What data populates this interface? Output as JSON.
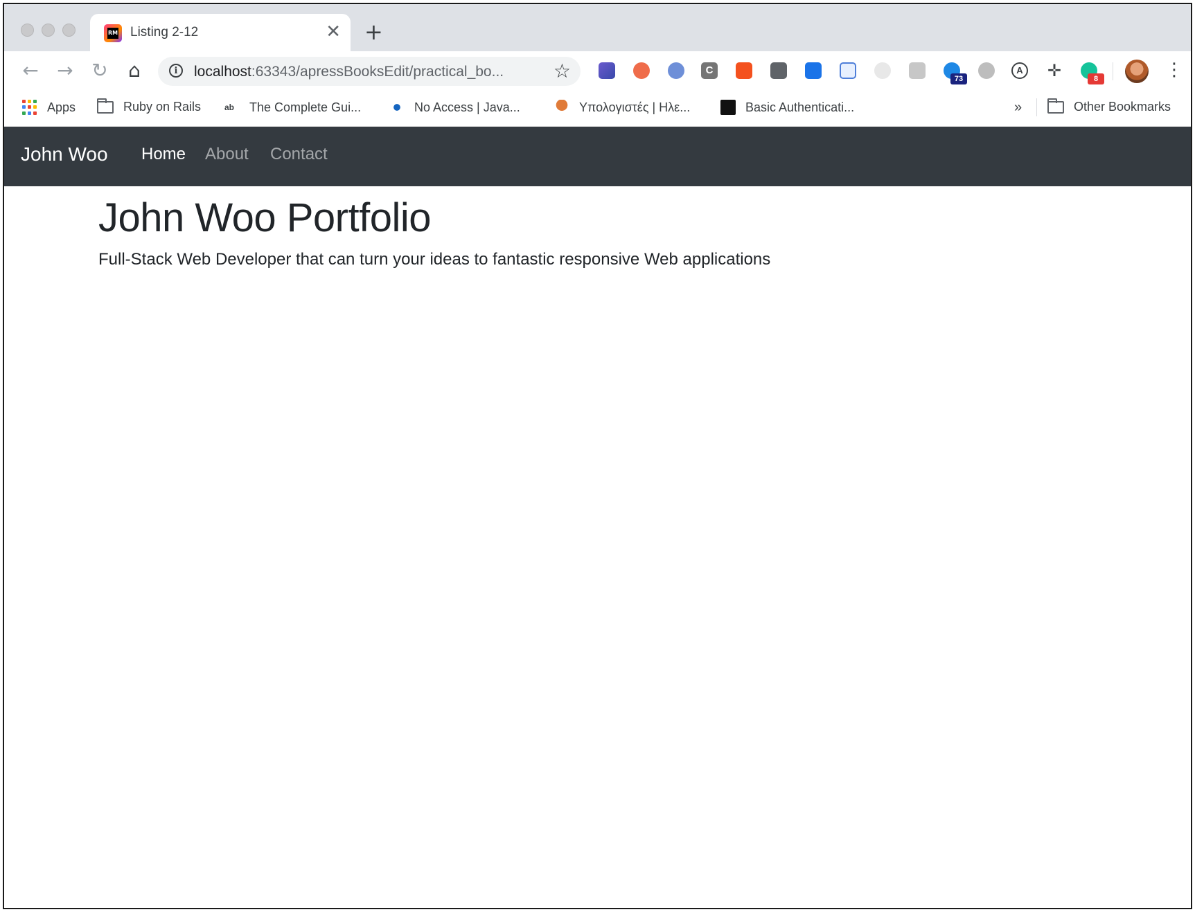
{
  "browser": {
    "tab": {
      "title": "Listing 2-12",
      "favicon": "RM"
    },
    "address": {
      "host": "localhost",
      "rest": ":63343/apressBooksEdit/practical_bo..."
    },
    "extensions": [
      {
        "name": "eyedropper-icon",
        "badge": ""
      },
      {
        "name": "tree-icon",
        "badge": ""
      },
      {
        "name": "opera-icon",
        "badge": ""
      },
      {
        "name": "c-icon",
        "badge": ""
      },
      {
        "name": "gear-icon",
        "badge": ""
      },
      {
        "name": "lightbulb-icon",
        "badge": ""
      },
      {
        "name": "download-icon",
        "badge": ""
      },
      {
        "name": "speed-icon",
        "badge": ""
      },
      {
        "name": "react-icon",
        "badge": ""
      },
      {
        "name": "chat-icon",
        "badge": ""
      },
      {
        "name": "cloud-icon",
        "badge": "73"
      },
      {
        "name": "vpn-icon",
        "badge": ""
      },
      {
        "name": "a-circle-icon",
        "badge": ""
      },
      {
        "name": "ruler-icon",
        "badge": ""
      },
      {
        "name": "grammarly-icon",
        "badge": "8"
      }
    ],
    "bookmarks": {
      "apps": "Apps",
      "items": [
        "Ruby on Rails",
        "The Complete Gui...",
        "No Access | Java...",
        "Υπολογιστές | Ηλε...",
        "Basic Authenticati..."
      ],
      "overflow": "»",
      "other": "Other Bookmarks"
    },
    "colors": {
      "navbar": "#343a40",
      "tabstrip": "#dee1e6"
    }
  },
  "site": {
    "brand": "John Woo",
    "nav": [
      "Home",
      "About",
      "Contact"
    ],
    "heading": "John Woo Portfolio",
    "lead": "Full-Stack Web Developer that can turn your ideas to fantastic responsive Web applications"
  }
}
